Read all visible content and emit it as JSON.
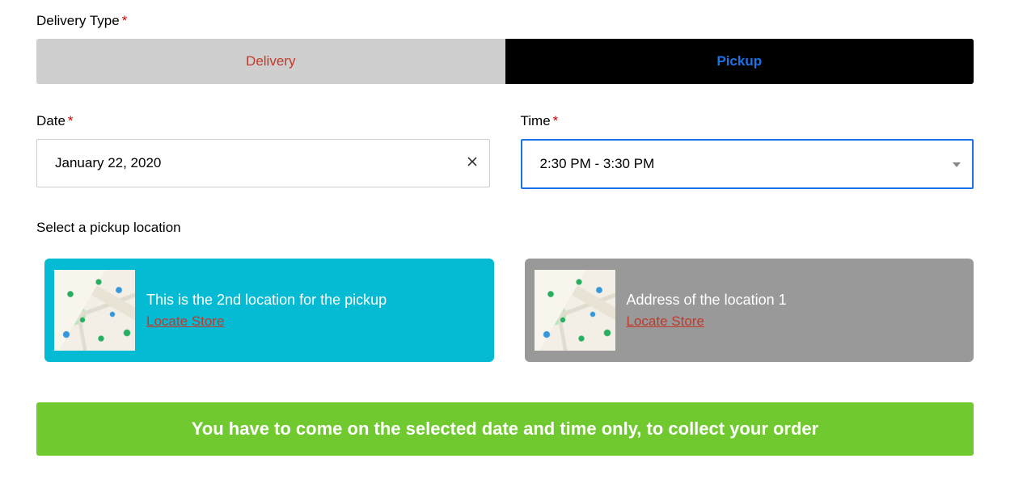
{
  "deliveryType": {
    "label": "Delivery Type",
    "options": {
      "delivery": "Delivery",
      "pickup": "Pickup"
    }
  },
  "date": {
    "label": "Date",
    "value": "January 22, 2020"
  },
  "time": {
    "label": "Time",
    "value": "2:30 PM - 3:30 PM"
  },
  "locationHeading": "Select a pickup location",
  "locations": [
    {
      "title": "This is the 2nd location for the pickup",
      "link": "Locate Store"
    },
    {
      "title": "Address of the location 1",
      "link": "Locate Store"
    }
  ],
  "notice": "You have to come on the selected date and time only, to collect your order"
}
